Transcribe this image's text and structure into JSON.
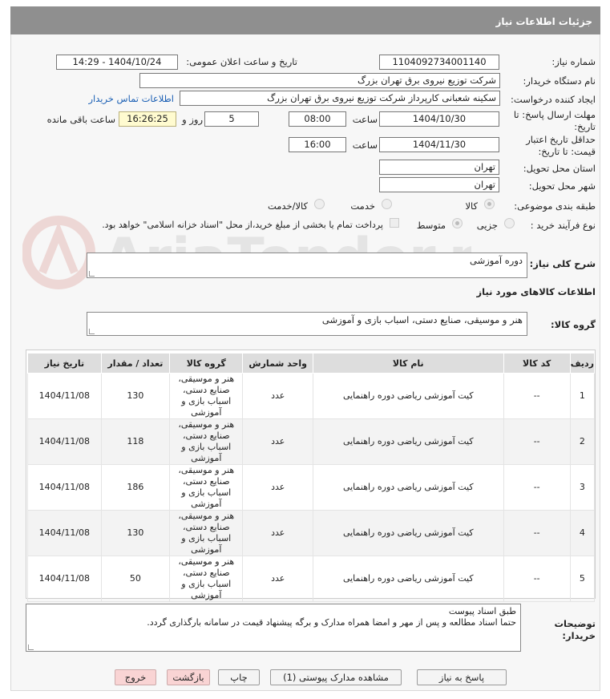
{
  "header": {
    "title": "جزئیات اطلاعات نیاز"
  },
  "form": {
    "need_number_label": "شماره نیاز:",
    "need_number": "1104092734001140",
    "announce_label": "تاریخ و ساعت اعلان عمومی:",
    "announce_value": "1404/10/24 - 14:29",
    "buyer_label": "نام دستگاه خریدار:",
    "buyer_value": "شرکت توزیع نیروی برق تهران بزرگ",
    "creator_label": "ایجاد کننده درخواست:",
    "creator_value": "سکینه شعبانی کارپرداز شرکت توزیع نیروی برق تهران بزرگ",
    "contact_link": "اطلاعات تماس خریدار",
    "deadline_label_1": "مهلت ارسال پاسخ: تا",
    "deadline_label_2": "تاریخ:",
    "deadline_date": "1404/10/30",
    "time_label": "ساعت",
    "deadline_time": "08:00",
    "days_value": "5",
    "days_label": "روز و",
    "remaining_time": "16:26:25",
    "remaining_label": "ساعت باقی مانده",
    "validity_label_1": "حداقل تاریخ اعتبار",
    "validity_label_2": "قیمت: تا تاریخ:",
    "validity_date": "1404/11/30",
    "validity_time": "16:00",
    "province_label": "استان محل تحویل:",
    "province_value": "تهران",
    "city_label": "شهر محل تحویل:",
    "city_value": "تهران",
    "category_label": "طبقه بندی موضوعی:",
    "category_options": [
      "کالا",
      "خدمت",
      "کالا/خدمت"
    ],
    "process_label": "نوع فرآیند خرید :",
    "process_options": [
      "جزیی",
      "متوسط"
    ],
    "payment_note": "پرداخت تمام یا بخشی از مبلغ خرید،از محل \"اسناد خزانه اسلامی\" خواهد بود.",
    "summary_label": "شرح کلی نیاز:",
    "summary_value": "دوره آموزشی",
    "goods_info_title": "اطلاعات کالاهای مورد نیاز",
    "goods_group_label": "گروه کالا:",
    "goods_group_value": "هنر و موسیقی، صنایع دستی، اسباب بازی و آموزشی"
  },
  "table": {
    "headers": [
      "ردیف",
      "کد کالا",
      "نام کالا",
      "واحد شمارش",
      "گروه کالا",
      "تعداد / مقدار",
      "تاریخ نیاز"
    ],
    "rows": [
      {
        "row": "1",
        "code": "--",
        "name": "کیت آموزشی ریاضی دوره راهنمایی",
        "unit": "عدد",
        "group": "هنر و موسیقی، صنایع دستی، اسباب بازی و آموزشی",
        "qty": "130",
        "date": "1404/11/08"
      },
      {
        "row": "2",
        "code": "--",
        "name": "کیت آموزشی ریاضی دوره راهنمایی",
        "unit": "عدد",
        "group": "هنر و موسیقی، صنایع دستی، اسباب بازی و آموزشی",
        "qty": "118",
        "date": "1404/11/08"
      },
      {
        "row": "3",
        "code": "--",
        "name": "کیت آموزشی ریاضی دوره راهنمایی",
        "unit": "عدد",
        "group": "هنر و موسیقی، صنایع دستی، اسباب بازی و آموزشی",
        "qty": "186",
        "date": "1404/11/08"
      },
      {
        "row": "4",
        "code": "--",
        "name": "کیت آموزشی ریاضی دوره راهنمایی",
        "unit": "عدد",
        "group": "هنر و موسیقی، صنایع دستی، اسباب بازی و آموزشی",
        "qty": "130",
        "date": "1404/11/08"
      },
      {
        "row": "5",
        "code": "--",
        "name": "کیت آموزشی ریاضی دوره راهنمایی",
        "unit": "عدد",
        "group": "هنر و موسیقی، صنایع دستی، اسباب بازی و آموزشی",
        "qty": "50",
        "date": "1404/11/08"
      }
    ]
  },
  "notes": {
    "label_1": "توضیحات",
    "label_2": "خریدار:",
    "line_1": "طبق اسناد پیوست",
    "line_2": "حتما اسناد مطالعه و پس از مهر و امضا همراه مدارک و برگه پیشنهاد قیمت در سامانه بارگذاری گردد."
  },
  "buttons": {
    "reply": "پاسخ به نیاز",
    "attachments": "مشاهده مدارک پیوستی (1)",
    "print": "چاپ",
    "back": "بازگشت",
    "exit": "خروج"
  },
  "watermark": {
    "text": "AriaTender.neT"
  }
}
